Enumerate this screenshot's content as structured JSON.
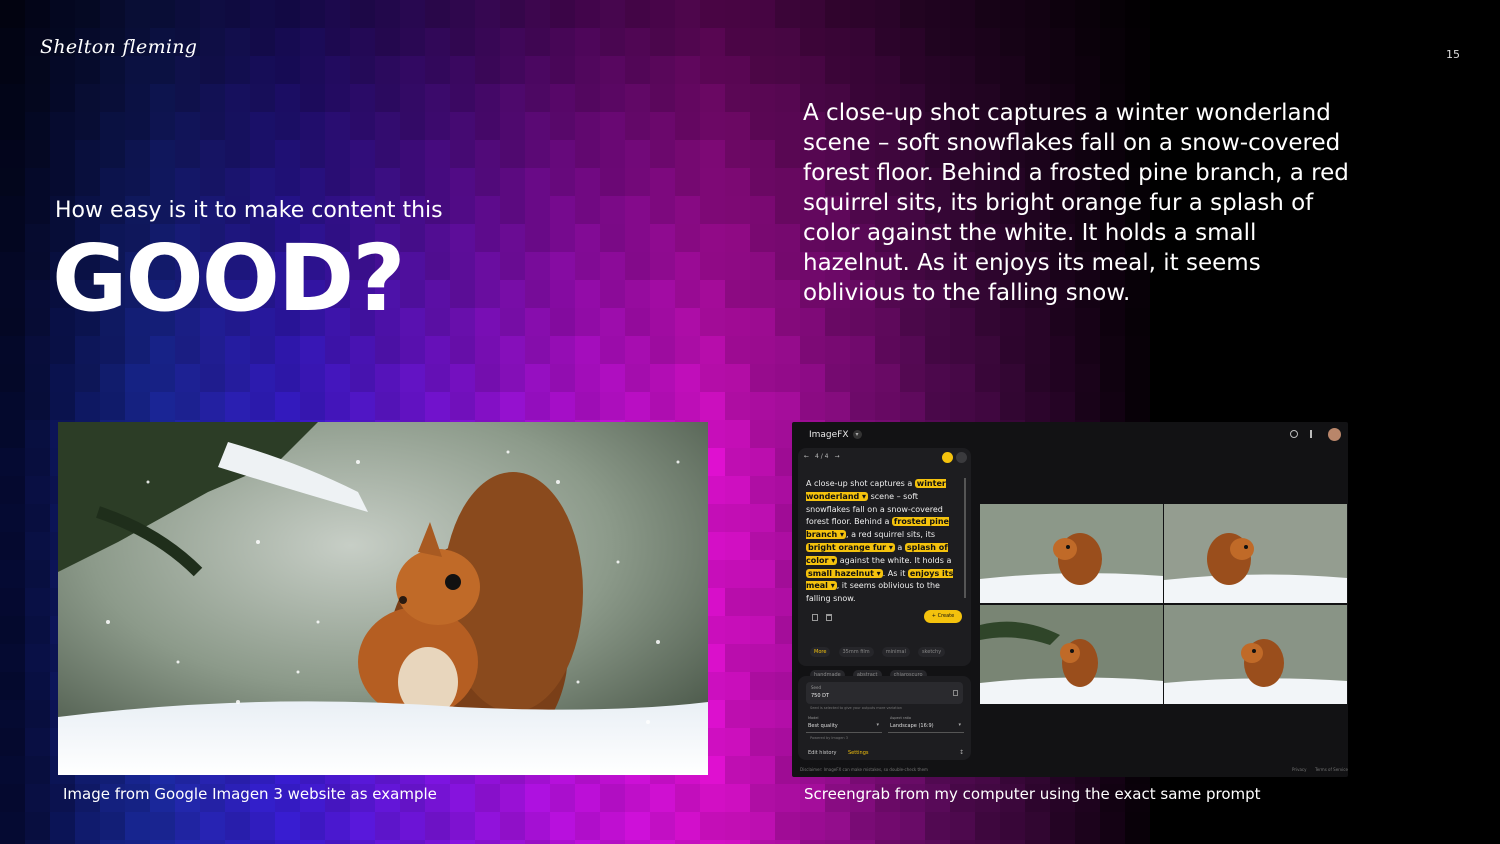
{
  "slide": {
    "logo": "Shelton fleming",
    "page_number": "15",
    "intro_line": "How easy is it to make content this",
    "headline": "GOOD?",
    "prompt_text": "A close-up shot captures a winter wonderland scene – soft snowflakes fall on a snow-covered forest floor. Behind a frosted pine branch, a red squirrel sits, its bright orange fur a splash of color against the white. It holds a small hazelnut. As it enjoys its meal, it seems oblivious to the falling snow.",
    "caption_left": "Image from Google Imagen 3 website as example",
    "caption_right": "Screengrab from my computer using the exact same prompt"
  },
  "colors": {
    "accent_yellow": "#f4c20d",
    "gradient": [
      "#050a33",
      "#1a2aa0",
      "#3a1cd6",
      "#7a14e0",
      "#c010e0",
      "#e010d0",
      "#5a0a5a",
      "#000000"
    ]
  },
  "imagefx": {
    "app_title": "ImageFX",
    "nav": {
      "back": "←",
      "counter": "4 / 4",
      "forward": "→"
    },
    "prompt_parts": {
      "p1": "A close-up shot captures a ",
      "c1": "winter wonderland ▾",
      "p2": " scene – soft snowflakes fall on a snow-covered forest floor. Behind a ",
      "c2": "frosted pine branch ▾",
      "p3": ", a red squirrel sits, its ",
      "c3": "bright orange fur ▾",
      "p4": " a ",
      "c4": "splash of color ▾",
      "p5": " against the white. It holds a ",
      "c5": "small hazelnut ▾",
      "p6": ". As it ",
      "c6": "enjoys its meal ▾",
      "p7": ", it seems oblivious to the falling snow."
    },
    "create_label": "+ Create",
    "styles": [
      "More",
      "35mm film",
      "minimal",
      "sketchy",
      "handmade",
      "abstract",
      "chiaroscuro"
    ],
    "seed": {
      "label": "Seed",
      "value": "750 DT",
      "hint": "Seed is selected to give your outputs more variation"
    },
    "model": {
      "label": "Model",
      "value": "Best quality"
    },
    "aspect": {
      "label": "Aspect ratio",
      "value": "Landscape (16:9)"
    },
    "powered_by": "Powered by Imagen 3",
    "tabs": {
      "history": "Edit history",
      "settings": "Settings"
    },
    "disclaimer": "Disclaimer: ImageFX can make mistakes, so double-check them",
    "footer_links": {
      "privacy": "Privacy",
      "terms": "Terms of Service"
    }
  }
}
